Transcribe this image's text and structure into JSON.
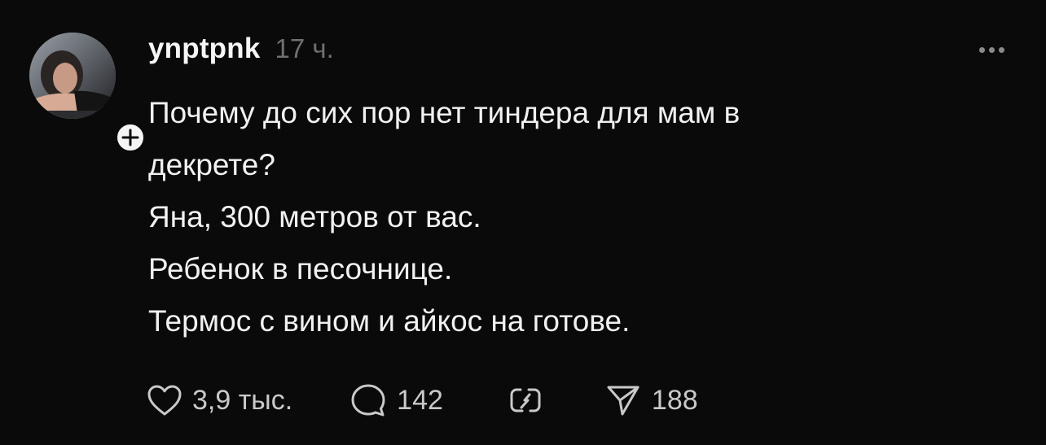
{
  "post": {
    "username": "ynptpnk",
    "time": "17 ч.",
    "lines": [
      "Почему до сих пор нет тиндера для мам в",
      "декрете?",
      "Яна, 300 метров от вас.",
      "Ребенок в песочнице.",
      "Термос с вином и айкос на готове."
    ]
  },
  "actions": {
    "likes": "3,9 тыс.",
    "replies": "142",
    "shares": "188"
  },
  "icons": {
    "more": "more-horizontal-icon",
    "follow": "plus-icon",
    "like": "heart-icon",
    "reply": "comment-bubble-icon",
    "repost": "repost-icon",
    "share": "send-icon"
  },
  "colors": {
    "background": "#0a0a0a",
    "text": "#f1f1f1",
    "muted": "#6f6f6f",
    "icon": "#c9c9c9"
  }
}
